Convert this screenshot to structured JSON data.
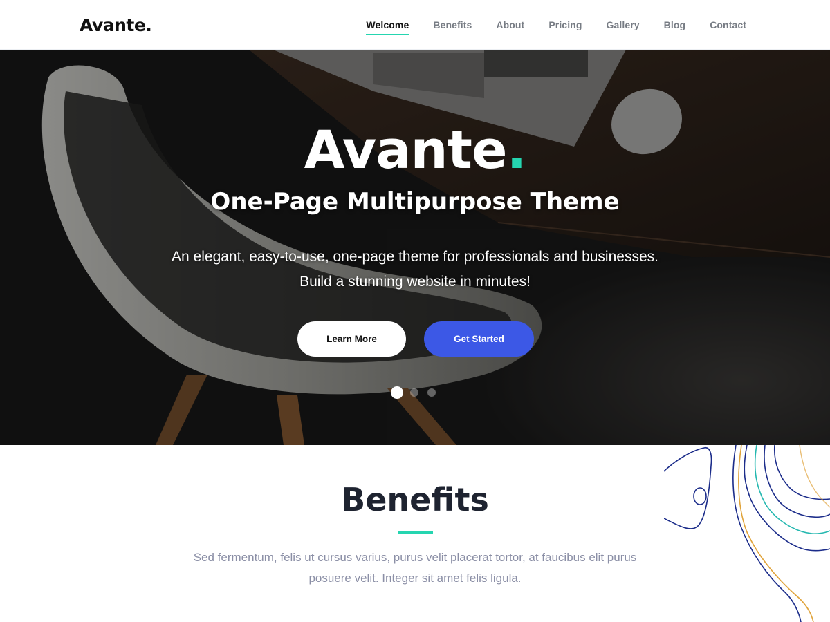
{
  "header": {
    "logo": "Avante.",
    "nav": [
      "Welcome",
      "Benefits",
      "About",
      "Pricing",
      "Gallery",
      "Blog",
      "Contact"
    ],
    "active_nav": "Welcome"
  },
  "hero": {
    "title": "Avante",
    "title_dot": ".",
    "subtitle": "One-Page Multipurpose Theme",
    "description_line1": "An elegant, easy-to-use, one-page theme for professionals and businesses.",
    "description_line2": "Build a stunning website in minutes!",
    "learn_more_label": "Learn More",
    "get_started_label": "Get Started",
    "slider_count": 3,
    "slider_active_index": 0
  },
  "benefits": {
    "title": "Benefits",
    "description_line1": "Sed fermentum, felis ut cursus varius, purus velit placerat tortor, at faucibus elit purus",
    "description_line2": "posuere velit. Integer sit amet felis ligula."
  },
  "colors": {
    "accent": "#25d5b0",
    "primary_button": "#3c58e6",
    "heading": "#1e2330",
    "body_text": "#8b8fa6"
  }
}
